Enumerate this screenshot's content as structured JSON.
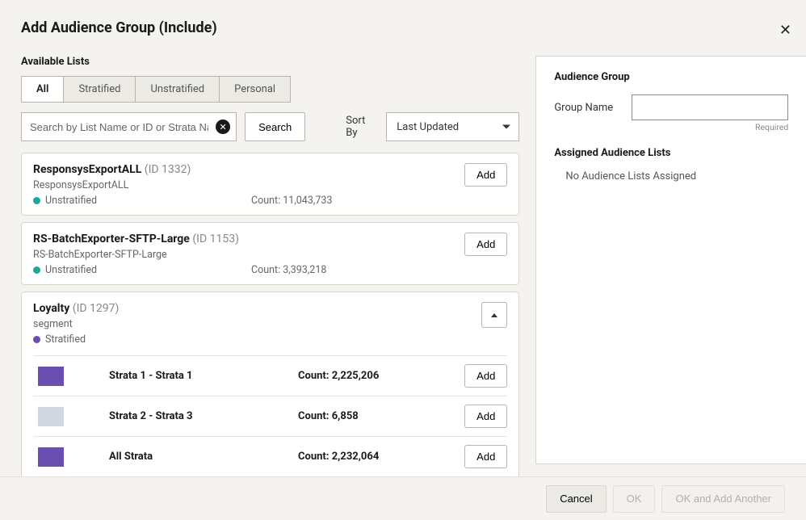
{
  "dialog": {
    "title": "Add Audience Group (Include)",
    "close_aria": "Close"
  },
  "left": {
    "heading": "Available Lists",
    "tabs": [
      "All",
      "Stratified",
      "Unstratified",
      "Personal"
    ],
    "active_tab_index": 0,
    "search": {
      "placeholder": "Search by List Name or ID or Strata Name",
      "button": "Search"
    },
    "sort": {
      "label": "Sort By",
      "selected": "Last Updated"
    },
    "add_label": "Add",
    "lists": [
      {
        "name": "ResponsysExportALL",
        "id_label": "(ID 1332)",
        "sub": "ResponsysExportALL",
        "strat_type": "Unstratified",
        "strat_color": "teal",
        "count_label": "Count: 11,043,733"
      },
      {
        "name": "RS-BatchExporter-SFTP-Large",
        "id_label": "(ID 1153)",
        "sub": "RS-BatchExporter-SFTP-Large",
        "strat_type": "Unstratified",
        "strat_color": "teal",
        "count_label": "Count: 3,393,218"
      },
      {
        "name": "Loyalty",
        "id_label": "(ID 1297)",
        "sub": "segment",
        "strat_type": "Stratified",
        "strat_color": "purple",
        "expanded": true,
        "strata": [
          {
            "swatch": "#6a4fb0",
            "name": "Strata 1 - Strata 1",
            "count_label": "Count: 2,225,206"
          },
          {
            "swatch": "#d1d6e0",
            "name": "Strata 2 - Strata 3",
            "count_label": "Count: 6,858"
          },
          {
            "swatch": "#6a4fb0",
            "name": "All Strata",
            "count_label": "Count: 2,232,064"
          }
        ]
      }
    ]
  },
  "right": {
    "heading": "Audience Group",
    "group_name_label": "Group Name",
    "group_name_value": "",
    "required_label": "Required",
    "assigned_heading": "Assigned Audience Lists",
    "empty_msg": "No Audience Lists Assigned"
  },
  "footer": {
    "cancel": "Cancel",
    "ok": "OK",
    "ok_add_another": "OK and Add Another"
  }
}
